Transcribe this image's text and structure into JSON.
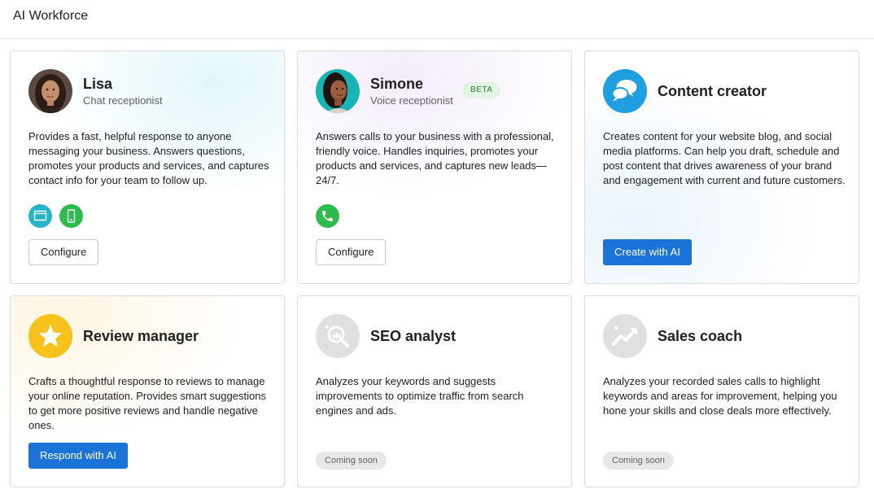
{
  "header": {
    "title": "AI Workforce"
  },
  "colors": {
    "primary_button": "#1a73d6",
    "beta_bg": "#e4f4e4",
    "beta_text": "#2e7d32",
    "chat_channel": "#26b5c6",
    "sms_channel": "#2dbb4e",
    "phone_channel": "#2dbb4e",
    "content_icon": "#1f9ee0",
    "review_icon": "#f6c21b",
    "disabled_icon": "#e0e0e0",
    "coming_soon_bg": "#e8e8e8"
  },
  "cards": [
    {
      "name": "Lisa",
      "subtitle": "Chat receptionist",
      "avatar": "woman-portrait",
      "description": "Provides a fast, helpful response to anyone messaging your business. Answers questions, promotes your products and services, and captures contact info for your team to follow up.",
      "channels": [
        "chat-widget-icon",
        "mobile-phone-icon"
      ],
      "action": "Configure"
    },
    {
      "name": "Simone",
      "subtitle": "Voice receptionist",
      "badge": "BETA",
      "avatar": "woman-portrait",
      "description": "Answers calls to your business with a professional, friendly voice. Handles inquiries, promotes your products and services, and captures new leads—24/7.",
      "channels": [
        "phone-icon"
      ],
      "action": "Configure"
    },
    {
      "name": "Content creator",
      "icon": "chat-bubbles-icon",
      "description": "Creates content for your website blog, and social media platforms. Can help you draft, schedule and post content that drives awareness of your brand and engagement with current and future customers.",
      "action": "Create with AI"
    },
    {
      "name": "Review manager",
      "icon": "star-icon",
      "description": "Crafts a thoughtful response to reviews to manage your online reputation. Provides smart suggestions to get more positive reviews and handle negative ones.",
      "action": "Respond with AI"
    },
    {
      "name": "SEO analyst",
      "icon": "seo-search-icon",
      "description": "Analyzes your keywords and suggests improvements to optimize traffic from search engines and ads.",
      "status": "Coming soon"
    },
    {
      "name": "Sales coach",
      "icon": "trending-up-icon",
      "description": "Analyzes your recorded sales calls to highlight keywords and areas for improvement, helping you hone your skills and close deals more effectively.",
      "status": "Coming soon"
    }
  ]
}
